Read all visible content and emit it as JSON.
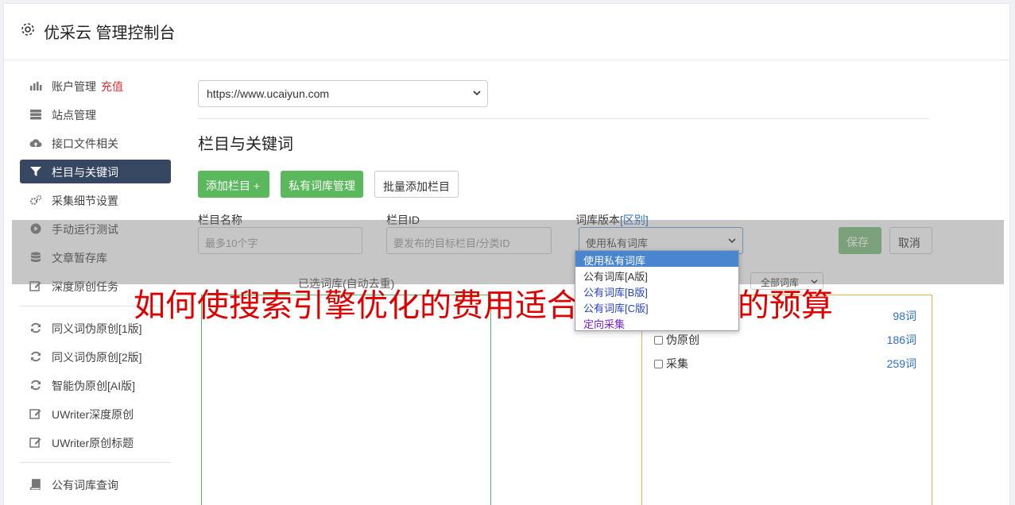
{
  "header": {
    "title": "优采云 管理控制台"
  },
  "sidebar": {
    "items": [
      {
        "label": "账户管理",
        "extra": "充值",
        "icon": "bar-chart-icon"
      },
      {
        "label": "站点管理",
        "icon": "server-icon"
      },
      {
        "label": "接口文件相关",
        "icon": "cloud-upload-icon"
      },
      {
        "label": "栏目与关键词",
        "icon": "filter-icon",
        "active": true
      },
      {
        "label": "采集细节设置",
        "icon": "cogs-icon"
      },
      {
        "label": "手动运行测试",
        "icon": "play-icon"
      },
      {
        "label": "文章暂存库",
        "icon": "database-icon"
      },
      {
        "label": "深度原创任务",
        "icon": "edit-icon"
      },
      {
        "label": "同义词伪原创[1版]",
        "icon": "refresh-icon"
      },
      {
        "label": "同义词伪原创[2版]",
        "icon": "refresh-icon"
      },
      {
        "label": "智能伪原创[AI版]",
        "icon": "refresh-icon"
      },
      {
        "label": "UWriter深度原创",
        "icon": "edit-icon"
      },
      {
        "label": "UWriter原创标题",
        "icon": "edit-icon"
      },
      {
        "label": "公有词库查询",
        "icon": "book-icon"
      }
    ]
  },
  "main": {
    "site_select": "https://www.ucaiyun.com",
    "section_title": "栏目与关键词",
    "buttons": {
      "add_column": "添加栏目 +",
      "private_lib": "私有词库管理",
      "batch_add": "批量添加栏目"
    },
    "form": {
      "name_label": "栏目名称",
      "name_placeholder": "最多10个字",
      "id_label": "栏目ID",
      "id_placeholder": "要发布的目标栏目/分类ID",
      "version_label": "词库版本",
      "version_link": "[区别]",
      "version_value": "使用私有词库",
      "save": "保存",
      "cancel": "取消"
    },
    "selected_lib_label": "已选词库(自动去重)",
    "filter_select": "全部词库",
    "lib_list": [
      {
        "name": "",
        "count": "98词"
      },
      {
        "name": "伪原创",
        "count": "186词"
      },
      {
        "name": "采集",
        "count": "259词"
      }
    ],
    "dropdown_options": [
      "使用私有词库",
      "公有词库[A版]",
      "公有词库[B版]",
      "公有词库[C版]",
      "定向采集"
    ]
  },
  "banner": "如何使搜索引擎优化的费用适合于中小企业的预算",
  "colors": {
    "active_nav": "#374761",
    "green": "#5cb85c",
    "banner": "#e00000",
    "link": "#2a6fc9"
  }
}
